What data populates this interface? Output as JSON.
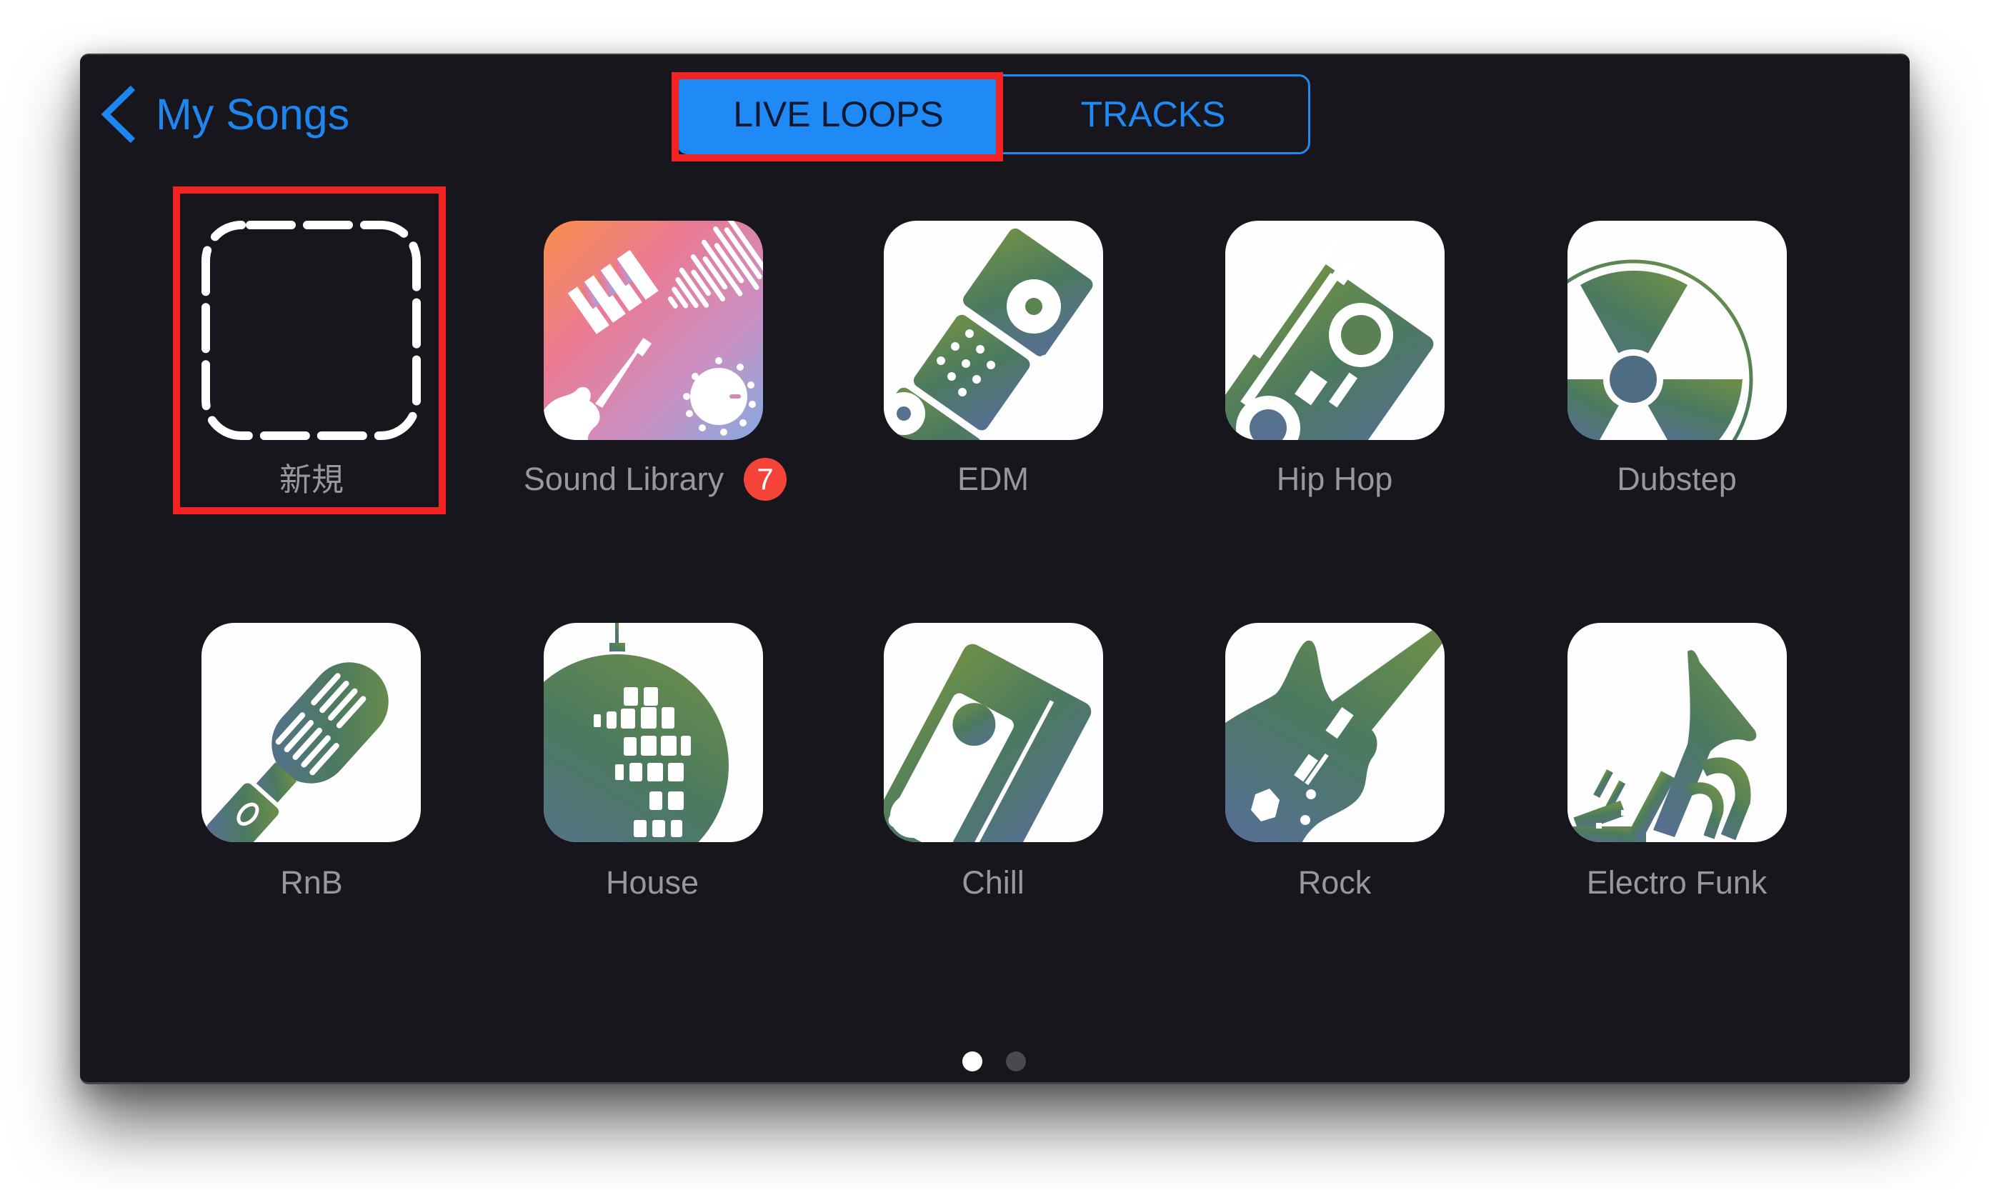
{
  "header": {
    "back_label": "My Songs",
    "back_icon": "chevron-left-icon"
  },
  "segmented_control": {
    "tabs": [
      {
        "label": "LIVE LOOPS",
        "selected": true,
        "highlighted": true
      },
      {
        "label": "TRACKS",
        "selected": false
      }
    ]
  },
  "templates": [
    {
      "label": "新規",
      "icon": "new-dashed-square-icon",
      "highlighted": true
    },
    {
      "label": "Sound Library",
      "icon": "sound-library-icon",
      "badge": "7"
    },
    {
      "label": "EDM",
      "icon": "drum-machine-icon"
    },
    {
      "label": "Hip Hop",
      "icon": "boombox-icon"
    },
    {
      "label": "Dubstep",
      "icon": "radiation-record-icon"
    },
    {
      "label": "RnB",
      "icon": "microphone-icon"
    },
    {
      "label": "House",
      "icon": "disco-ball-icon"
    },
    {
      "label": "Chill",
      "icon": "cassette-tape-icon"
    },
    {
      "label": "Rock",
      "icon": "electric-guitar-icon"
    },
    {
      "label": "Electro Funk",
      "icon": "trumpet-icon"
    }
  ],
  "pagination": {
    "pages": 2,
    "current": 1
  },
  "colors": {
    "accent": "#1f8af5",
    "window_bg": "#17161c",
    "label_gray": "#98979c",
    "badge_red": "#f5433a",
    "highlight_red": "#f42323",
    "glyph_gradient_start": "#5f8049",
    "glyph_gradient_end": "#506c92",
    "sound_library_gradient": [
      "#f78c4b",
      "#e9789a",
      "#c690c7",
      "#86a9dd"
    ]
  }
}
